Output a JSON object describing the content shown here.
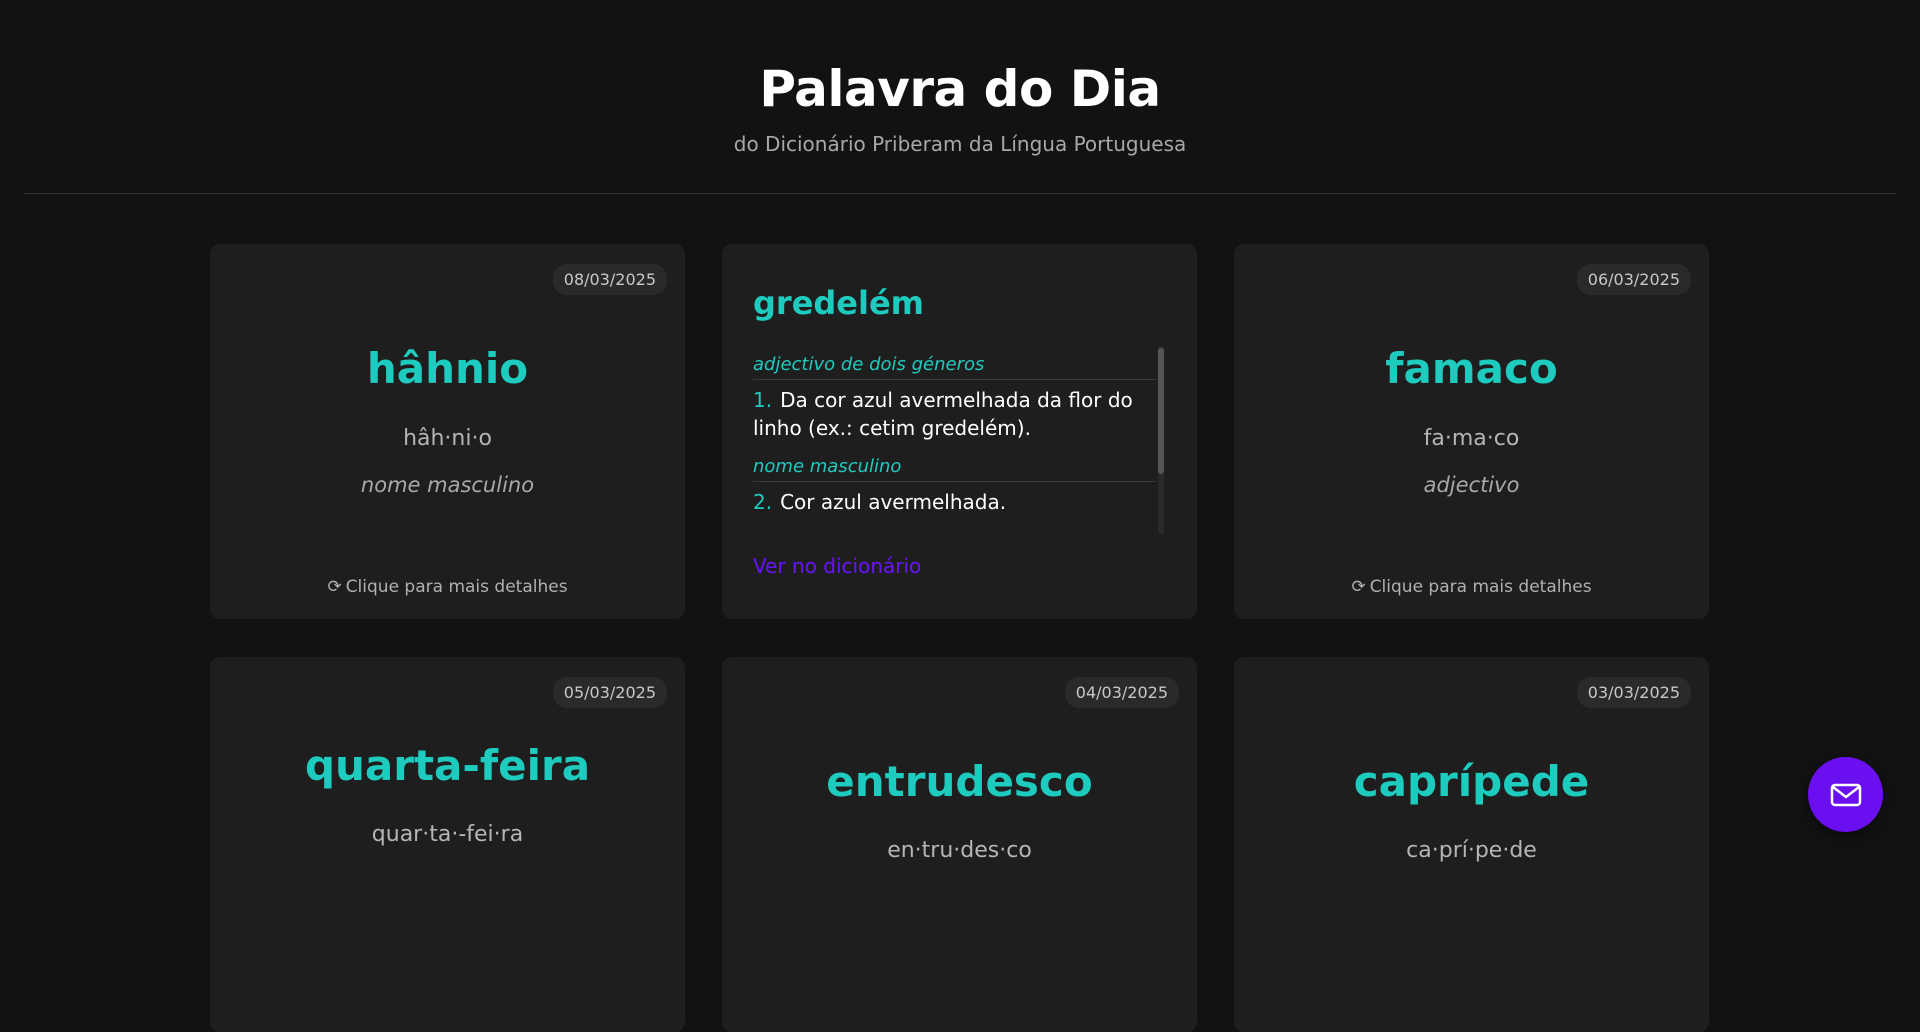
{
  "header": {
    "title": "Palavra do Dia",
    "subtitle": "do Dicionário Priberam da Língua Portuguesa"
  },
  "cards": [
    {
      "date": "08/03/2025",
      "word": "hâhnio",
      "syllables": "hâh·ni·o",
      "class": "nome masculino",
      "hint": "Clique para mais detalhes"
    },
    {
      "word": "gredelém",
      "definitions": [
        {
          "class": "adjectivo de dois géneros",
          "num": "1.",
          "text": "Da cor azul avermelhada da flor do linho (ex.: cetim gredelém)."
        },
        {
          "class": "nome masculino",
          "num": "2.",
          "text": "Cor azul avermelhada."
        }
      ],
      "link": "Ver no dicionário"
    },
    {
      "date": "06/03/2025",
      "word": "famaco",
      "syllables": "fa·ma·co",
      "class": "adjectivo",
      "hint": "Clique para mais detalhes"
    },
    {
      "date": "05/03/2025",
      "word": "quarta-feira",
      "syllables": "quar·ta·-fei·ra"
    },
    {
      "date": "04/03/2025",
      "word": "entrudesco",
      "syllables": "en·tru·des·co"
    },
    {
      "date": "03/03/2025",
      "word": "caprípede",
      "syllables": "ca·prí·pe·de"
    }
  ],
  "icons": {
    "refresh": "refresh-icon",
    "mail": "mail-icon"
  },
  "colors": {
    "accent": "#1ecbbf",
    "link": "#6a12ff",
    "fab": "#6a0ff0",
    "background": "#121212",
    "card": "#1e1e1e"
  }
}
